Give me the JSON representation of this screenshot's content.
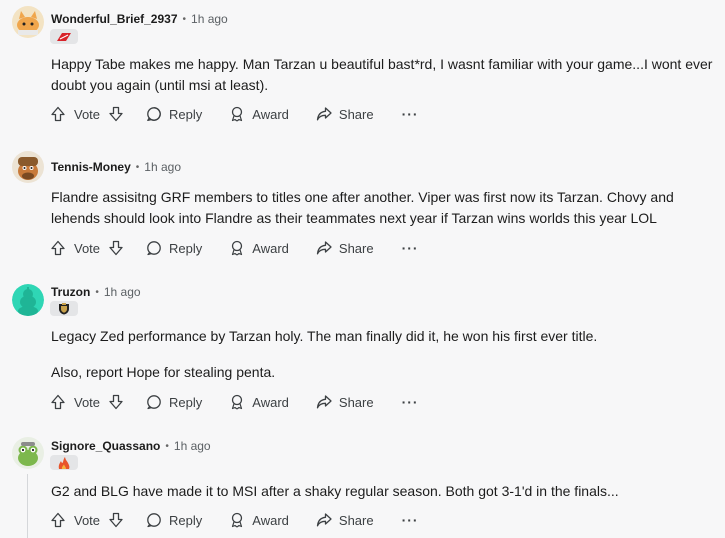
{
  "actions": {
    "vote": "Vote",
    "reply": "Reply",
    "award": "Award",
    "share": "Share",
    "more": "···"
  },
  "comments": [
    {
      "username": "Wonderful_Brief_2937",
      "time": "1h ago",
      "flair_icon": "team-flag-icon",
      "paragraphs": [
        "Happy Tabe makes me happy. Man Tarzan u beautiful bast*rd, I wasnt familiar with your game...I wont ever doubt you again (until msi at least)."
      ]
    },
    {
      "username": "Tennis-Money",
      "time": "1h ago",
      "paragraphs": [
        "Flandre assisitng GRF members to titles one after another. Viper was first now its Tarzan. Chovy and lehends should look into Flandre as their teammates next year if Tarzan wins worlds this year LOL"
      ]
    },
    {
      "username": "Truzon",
      "time": "1h ago",
      "flair_icon": "team-shield-icon",
      "paragraphs": [
        "Legacy Zed performance by Tarzan holy. The man finally did it, he won his first ever title.",
        "Also, report Hope for stealing penta."
      ]
    },
    {
      "username": "Signore_Quassano",
      "time": "1h ago",
      "flair_icon": "team-fire-icon",
      "paragraphs": [
        "G2 and BLG have made it to MSI after a shaky regular season. Both got 3-1'd in the finals..."
      ]
    }
  ],
  "colors": {
    "background": "#f7f7f8",
    "flair_bg": "#e4e5e7",
    "text": "#1c1c1c",
    "muted": "#5b6064"
  }
}
